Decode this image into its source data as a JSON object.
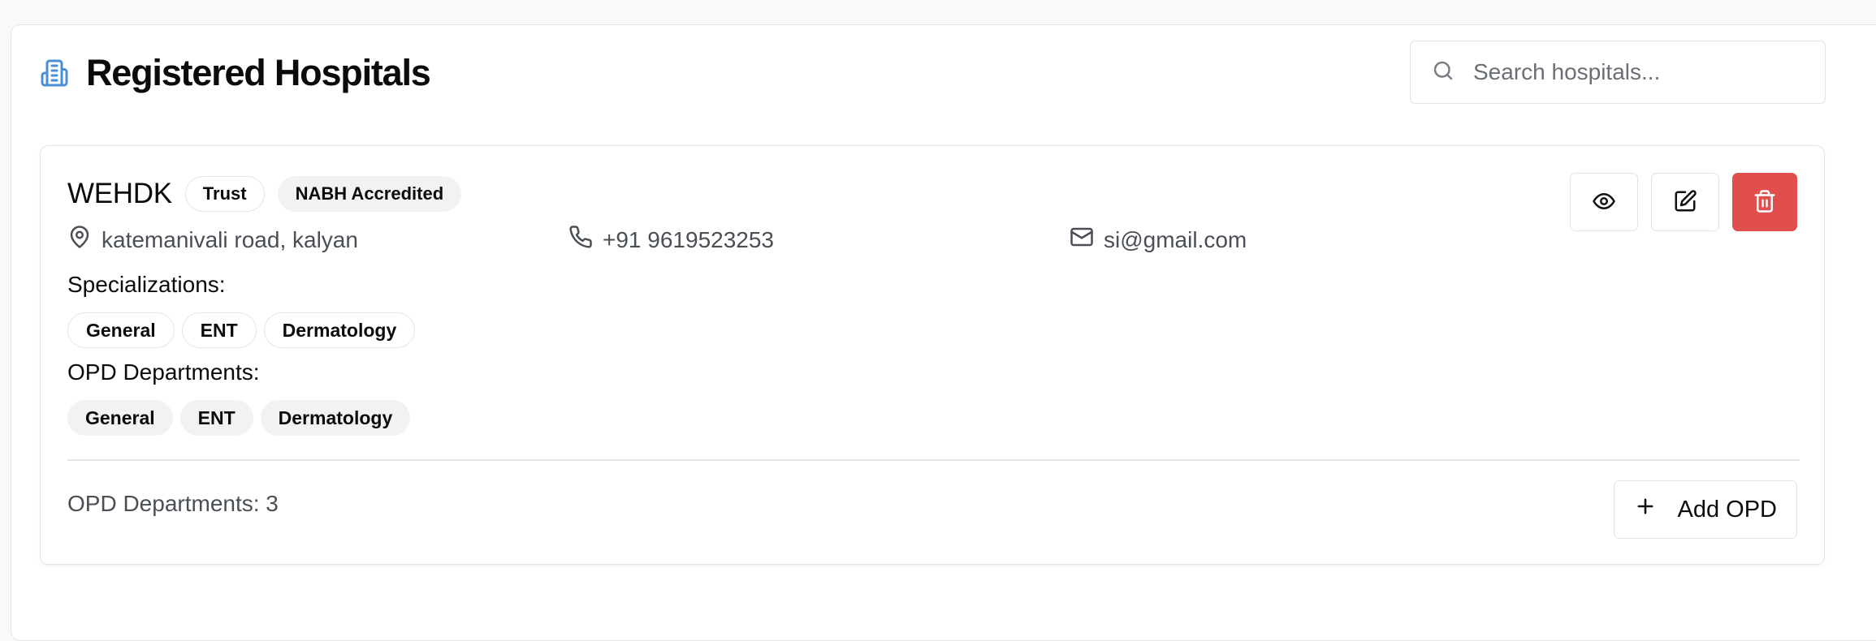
{
  "header": {
    "title": "Registered Hospitals",
    "icon": "hospital-building-icon",
    "icon_color": "#4a8fd6"
  },
  "search": {
    "placeholder": "Search hospitals...",
    "value": ""
  },
  "hospital": {
    "name": "WEHDK",
    "type_badge": "Trust",
    "accreditation_badge": "NABH Accredited",
    "address": "katemanivali road, kalyan",
    "phone": "+91 9619523253",
    "email": "si@gmail.com",
    "specializations_label": "Specializations:",
    "specializations": [
      "General",
      "ENT",
      "Dermatology"
    ],
    "opd_label": "OPD Departments:",
    "opd_departments": [
      "General",
      "ENT",
      "Dermatology"
    ],
    "opd_count_text": "OPD Departments: 3",
    "add_opd_label": "Add OPD"
  },
  "colors": {
    "danger": "#e04e4e",
    "accent_icon": "#4a8fd6"
  }
}
